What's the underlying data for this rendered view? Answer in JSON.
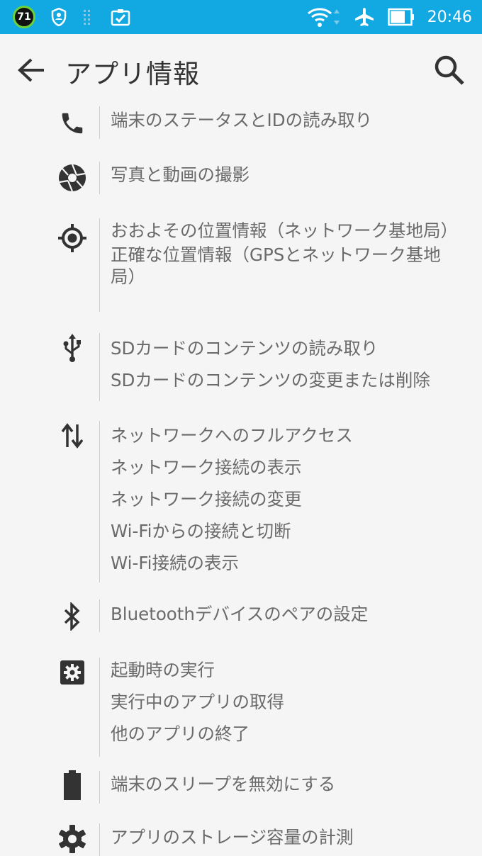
{
  "status_bar": {
    "badge": "71",
    "time": "20:46",
    "icons": [
      "battery-saver-badge-icon",
      "shield-user-icon",
      "dotted-grid-icon",
      "clipboard-check-icon",
      "wifi-icon",
      "airplane-icon",
      "battery-icon"
    ]
  },
  "app_bar": {
    "title": "アプリ情報",
    "back_icon": "arrow-back-icon",
    "search_icon": "search-icon"
  },
  "permission_groups": [
    {
      "icon": "phone-icon",
      "items": [
        "端末のステータスとIDの読み取り"
      ]
    },
    {
      "icon": "camera-shutter-icon",
      "items": [
        "写真と動画の撮影"
      ]
    },
    {
      "icon": "location-target-icon",
      "items": [
        "おおよその位置情報（ネットワーク基地局）",
        "正確な位置情報（GPSとネットワーク基地局）"
      ]
    },
    {
      "icon": "usb-icon",
      "items": [
        "SDカードのコンテンツの読み取り",
        "SDカードのコンテンツの変更または削除"
      ]
    },
    {
      "icon": "data-transfer-arrows-icon",
      "items": [
        "ネットワークへのフルアクセス",
        "ネットワーク接続の表示",
        "ネットワーク接続の変更",
        "Wi-Fiからの接続と切断",
        "Wi-Fi接続の表示"
      ]
    },
    {
      "icon": "bluetooth-icon",
      "items": [
        "Bluetoothデバイスのペアの設定"
      ]
    },
    {
      "icon": "settings-applications-icon",
      "items": [
        "起動時の実行",
        "実行中のアプリの取得",
        "他のアプリの終了"
      ]
    },
    {
      "icon": "battery-full-icon",
      "items": [
        "端末のスリープを無効にする"
      ]
    },
    {
      "icon": "gear-icon",
      "items": [
        "アプリのストレージ容量の計測"
      ]
    }
  ],
  "colors": {
    "status_bar": "#12a9e2",
    "background": "#f5f5f5",
    "text": "#6a6a6a",
    "icon": "#333333",
    "divider": "#cfcfcf"
  }
}
